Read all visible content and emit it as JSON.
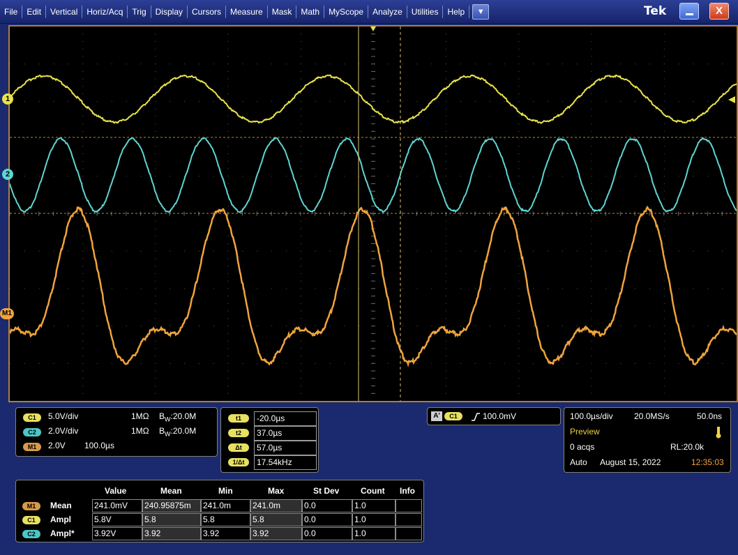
{
  "menu": {
    "items": [
      "File",
      "Edit",
      "Vertical",
      "Horiz/Acq",
      "Trig",
      "Display",
      "Cursors",
      "Measure",
      "Mask",
      "Math",
      "MyScope",
      "Analyze",
      "Utilities",
      "Help"
    ],
    "dropdown_glyph": "▼",
    "brand": "Tek",
    "minimize_icon": "minimize-icon",
    "close_glyph": "X"
  },
  "markers": {
    "ch1": "1",
    "ch2": "2",
    "m1": "M1"
  },
  "colors": {
    "ch1": "#e8e34b",
    "ch2": "#5ed6d2",
    "m1": "#f0a43c",
    "frame": "#ad7f3f",
    "background": "#000000"
  },
  "vertical": {
    "c1": {
      "badge": "C1",
      "scale": "5.0V/div",
      "impedance": "1MΩ",
      "bandwidth": "B",
      "bw_sub": "W",
      "bw_value": ":20.0M"
    },
    "c2": {
      "badge": "C2",
      "scale": "2.0V/div",
      "impedance": "1MΩ",
      "bandwidth": "B",
      "bw_sub": "W",
      "bw_value": ":20.0M"
    },
    "m1": {
      "badge": "M1",
      "scale": "2.0V",
      "time": "100.0µs"
    }
  },
  "cursors": {
    "t1": {
      "label": "t1",
      "value": "-20.0µs"
    },
    "t2": {
      "label": "t2",
      "value": "37.0µs"
    },
    "dt": {
      "label": "Δt",
      "value": "57.0µs"
    },
    "inv_dt": {
      "label": "1/Δt",
      "value": "17.54kHz"
    }
  },
  "trigger": {
    "mode_badge": "A'",
    "source": "C1",
    "slope_glyph": "⎍",
    "level": "100.0mV"
  },
  "horizontal": {
    "scale": "100.0µs/div",
    "sample_rate": "20.0MS/s",
    "resolution": "50.0ns",
    "status": "Preview",
    "acqs": "0 acqs",
    "record_length": "RL:20.0k",
    "trigger_mode": "Auto",
    "date": "August 15, 2022",
    "time": "12:35:03"
  },
  "measurements": {
    "headers": [
      "Value",
      "Mean",
      "Min",
      "Max",
      "St Dev",
      "Count",
      "Info"
    ],
    "rows": [
      {
        "source": "M1",
        "type": "Mean",
        "value": "241.0mV",
        "mean": "240.95875m",
        "min": "241.0m",
        "max": "241.0m",
        "stdev": "0.0",
        "count": "1.0",
        "info": ""
      },
      {
        "source": "C1",
        "type": "Ampl",
        "value": "5.8V",
        "mean": "5.8",
        "min": "5.8",
        "max": "5.8",
        "stdev": "0.0",
        "count": "1.0",
        "info": ""
      },
      {
        "source": "C2",
        "type": "Ampl*",
        "value": "3.92V",
        "mean": "3.92",
        "min": "3.92",
        "max": "3.92",
        "stdev": "0.0",
        "count": "1.0",
        "info": ""
      }
    ]
  }
}
